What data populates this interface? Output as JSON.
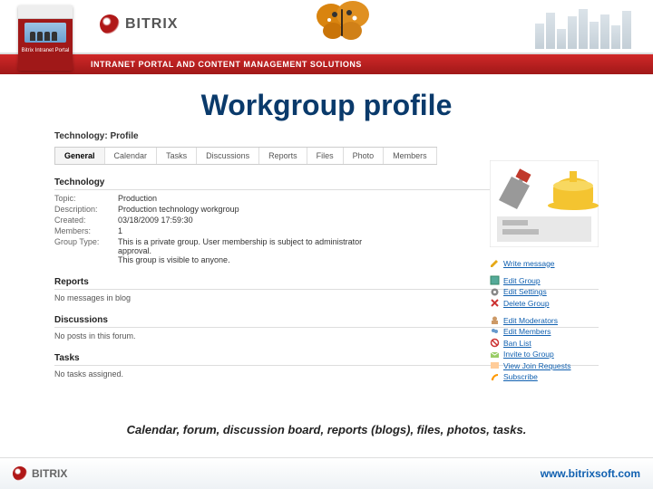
{
  "header": {
    "brand": "BITRIX",
    "red_box_label": "Bitrix Intranet Portal",
    "tagline": "INTRANET PORTAL AND CONTENT MANAGEMENT SOLUTIONS"
  },
  "title": "Workgroup profile",
  "breadcrumb": "Technology: Profile",
  "tabs": [
    "General",
    "Calendar",
    "Tasks",
    "Discussions",
    "Reports",
    "Files",
    "Photo",
    "Members"
  ],
  "active_tab": "General",
  "sections": {
    "technology": {
      "heading": "Technology",
      "rows": [
        {
          "label": "Topic:",
          "value": "Production"
        },
        {
          "label": "Description:",
          "value": "Production technology workgroup"
        },
        {
          "label": "Created:",
          "value": "03/18/2009 17:59:30"
        },
        {
          "label": "Members:",
          "value": "1"
        },
        {
          "label": "Group Type:",
          "value": "This is a private group. User membership is subject to administrator approval.\nThis group is visible to anyone."
        }
      ]
    },
    "reports": {
      "heading": "Reports",
      "empty": "No messages in blog"
    },
    "discussions": {
      "heading": "Discussions",
      "empty": "No posts in this forum."
    },
    "tasks": {
      "heading": "Tasks",
      "empty": "No tasks assigned."
    }
  },
  "side_links": {
    "group1": [
      {
        "icon": "pencil",
        "label": "Write message"
      }
    ],
    "group2": [
      {
        "icon": "edit",
        "label": "Edit Group"
      },
      {
        "icon": "gear",
        "label": "Edit Settings"
      },
      {
        "icon": "x",
        "label": "Delete Group"
      }
    ],
    "group3": [
      {
        "icon": "mods",
        "label": "Edit Moderators"
      },
      {
        "icon": "members",
        "label": "Edit Members"
      },
      {
        "icon": "ban",
        "label": "Ban List"
      },
      {
        "icon": "invite",
        "label": "Invite to Group"
      },
      {
        "icon": "join",
        "label": "View Join Requests"
      },
      {
        "icon": "sub",
        "label": "Subscribe"
      }
    ]
  },
  "caption": "Calendar, forum, discussion board, reports (blogs), files, photos, tasks.",
  "footer": {
    "brand": "BITRIX",
    "url": "www.bitrixsoft.com"
  }
}
